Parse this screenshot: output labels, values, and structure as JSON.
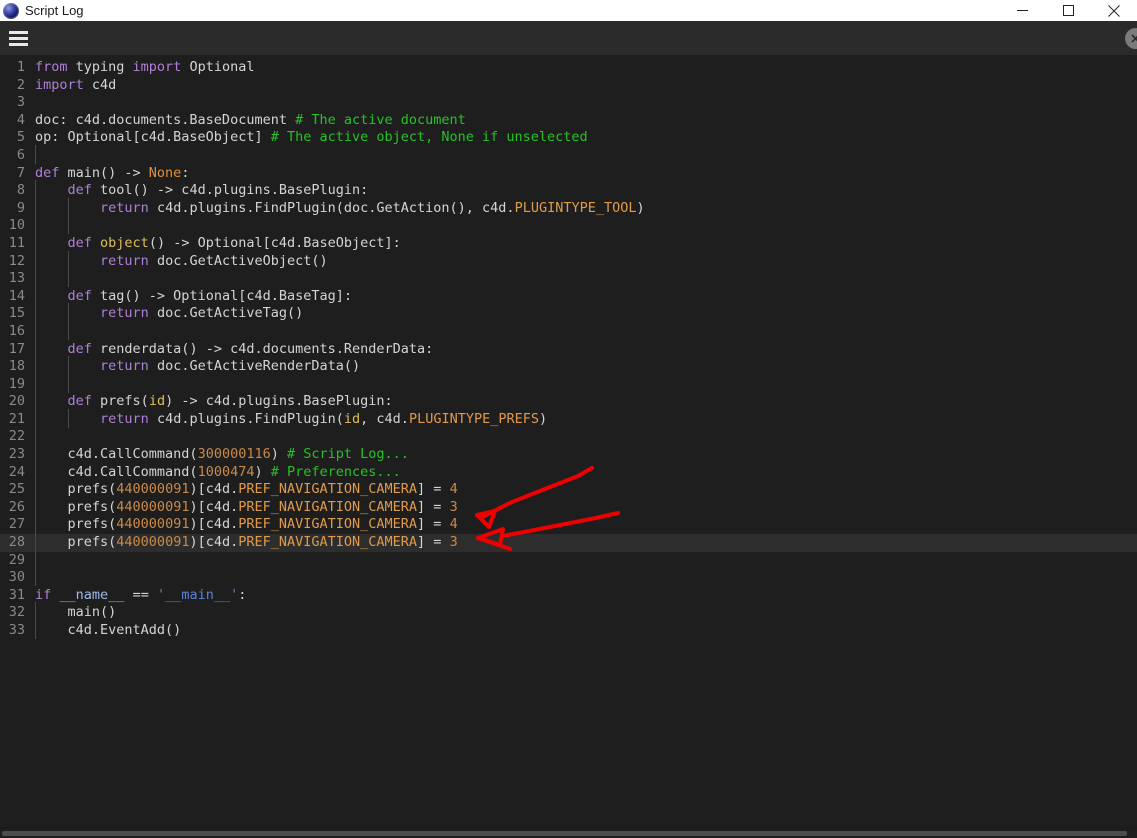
{
  "window": {
    "title": "Script Log",
    "app_icon": "c4d-sphere-icon",
    "controls": [
      {
        "name": "minimize-button",
        "glyph": "minimize-icon"
      },
      {
        "name": "maximize-button",
        "glyph": "maximize-icon"
      },
      {
        "name": "close-button",
        "glyph": "close-icon"
      }
    ]
  },
  "toolbar": {
    "menu_icon": "hamburger-menu-icon",
    "right_icon": "close-circle-icon"
  },
  "editor": {
    "current_line": 28,
    "total_lines": 33,
    "colors": {
      "background": "#1e1e1e",
      "gutter_text": "#8a8a8a",
      "current_line_bg": "#2d2d2d",
      "keyword": "#b07fd8",
      "builtin": "#e0bf56",
      "comment": "#26c226",
      "constant": "#e09a4a",
      "number": "#c98a49",
      "string": "#5a82d8",
      "plain": "#d4d4d4",
      "annotation": "#ee0000"
    },
    "lines": [
      {
        "n": 1,
        "indent": 0,
        "tokens": [
          {
            "t": "from",
            "c": "kw"
          },
          {
            "t": " typing ",
            "c": "plain"
          },
          {
            "t": "import",
            "c": "kw"
          },
          {
            "t": " Optional",
            "c": "plain"
          }
        ]
      },
      {
        "n": 2,
        "indent": 0,
        "tokens": [
          {
            "t": "import",
            "c": "kw"
          },
          {
            "t": " c4d",
            "c": "plain"
          }
        ]
      },
      {
        "n": 3,
        "indent": 0,
        "tokens": []
      },
      {
        "n": 4,
        "indent": 0,
        "tokens": [
          {
            "t": "doc: c4d.documents.BaseDocument ",
            "c": "plain"
          },
          {
            "t": "# The active document",
            "c": "cmt"
          }
        ]
      },
      {
        "n": 5,
        "indent": 0,
        "tokens": [
          {
            "t": "op: Optional[c4d.BaseObject] ",
            "c": "plain"
          },
          {
            "t": "# The active object, None if unselected",
            "c": "cmt"
          }
        ]
      },
      {
        "n": 6,
        "indent": 1,
        "tokens": []
      },
      {
        "n": 7,
        "indent": 0,
        "tokens": [
          {
            "t": "def",
            "c": "kw"
          },
          {
            "t": " main() -> ",
            "c": "plain"
          },
          {
            "t": "None",
            "c": "const"
          },
          {
            "t": ":",
            "c": "plain"
          }
        ]
      },
      {
        "n": 8,
        "indent": 1,
        "tokens": [
          {
            "t": "def",
            "c": "kw"
          },
          {
            "t": " tool() -> c4d.plugins.BasePlugin:",
            "c": "plain"
          }
        ]
      },
      {
        "n": 9,
        "indent": 2,
        "tokens": [
          {
            "t": "return",
            "c": "kw"
          },
          {
            "t": " c4d.plugins.FindPlugin(doc.GetAction(), c4d.",
            "c": "plain"
          },
          {
            "t": "PLUGINTYPE_TOOL",
            "c": "cst"
          },
          {
            "t": ")",
            "c": "plain"
          }
        ]
      },
      {
        "n": 10,
        "indent": 2,
        "tokens": []
      },
      {
        "n": 11,
        "indent": 1,
        "tokens": [
          {
            "t": "def",
            "c": "kw"
          },
          {
            "t": " ",
            "c": "plain"
          },
          {
            "t": "object",
            "c": "bi"
          },
          {
            "t": "() -> Optional[c4d.BaseObject]:",
            "c": "plain"
          }
        ]
      },
      {
        "n": 12,
        "indent": 2,
        "tokens": [
          {
            "t": "return",
            "c": "kw"
          },
          {
            "t": " doc.GetActiveObject()",
            "c": "plain"
          }
        ]
      },
      {
        "n": 13,
        "indent": 2,
        "tokens": []
      },
      {
        "n": 14,
        "indent": 1,
        "tokens": [
          {
            "t": "def",
            "c": "kw"
          },
          {
            "t": " tag() -> Optional[c4d.BaseTag]:",
            "c": "plain"
          }
        ]
      },
      {
        "n": 15,
        "indent": 2,
        "tokens": [
          {
            "t": "return",
            "c": "kw"
          },
          {
            "t": " doc.GetActiveTag()",
            "c": "plain"
          }
        ]
      },
      {
        "n": 16,
        "indent": 2,
        "tokens": []
      },
      {
        "n": 17,
        "indent": 1,
        "tokens": [
          {
            "t": "def",
            "c": "kw"
          },
          {
            "t": " renderdata() -> c4d.documents.RenderData:",
            "c": "plain"
          }
        ]
      },
      {
        "n": 18,
        "indent": 2,
        "tokens": [
          {
            "t": "return",
            "c": "kw"
          },
          {
            "t": " doc.GetActiveRenderData()",
            "c": "plain"
          }
        ]
      },
      {
        "n": 19,
        "indent": 2,
        "tokens": []
      },
      {
        "n": 20,
        "indent": 1,
        "tokens": [
          {
            "t": "def",
            "c": "kw"
          },
          {
            "t": " prefs(",
            "c": "plain"
          },
          {
            "t": "id",
            "c": "bi"
          },
          {
            "t": ") -> c4d.plugins.BasePlugin:",
            "c": "plain"
          }
        ]
      },
      {
        "n": 21,
        "indent": 2,
        "tokens": [
          {
            "t": "return",
            "c": "kw"
          },
          {
            "t": " c4d.plugins.FindPlugin(",
            "c": "plain"
          },
          {
            "t": "id",
            "c": "bi"
          },
          {
            "t": ", c4d.",
            "c": "plain"
          },
          {
            "t": "PLUGINTYPE_PREFS",
            "c": "cst"
          },
          {
            "t": ")",
            "c": "plain"
          }
        ]
      },
      {
        "n": 22,
        "indent": 1,
        "tokens": []
      },
      {
        "n": 23,
        "indent": 1,
        "tokens": [
          {
            "t": "c4d.CallCommand(",
            "c": "plain"
          },
          {
            "t": "300000116",
            "c": "num"
          },
          {
            "t": ") ",
            "c": "plain"
          },
          {
            "t": "# Script Log...",
            "c": "cmt"
          }
        ]
      },
      {
        "n": 24,
        "indent": 1,
        "tokens": [
          {
            "t": "c4d.CallCommand(",
            "c": "plain"
          },
          {
            "t": "1000474",
            "c": "num"
          },
          {
            "t": ") ",
            "c": "plain"
          },
          {
            "t": "# Preferences...",
            "c": "cmt"
          }
        ]
      },
      {
        "n": 25,
        "indent": 1,
        "tokens": [
          {
            "t": "prefs(",
            "c": "plain"
          },
          {
            "t": "440000091",
            "c": "num"
          },
          {
            "t": ")[c4d.",
            "c": "plain"
          },
          {
            "t": "PREF_NAVIGATION_CAMERA",
            "c": "cst"
          },
          {
            "t": "] = ",
            "c": "plain"
          },
          {
            "t": "4",
            "c": "num"
          }
        ]
      },
      {
        "n": 26,
        "indent": 1,
        "tokens": [
          {
            "t": "prefs(",
            "c": "plain"
          },
          {
            "t": "440000091",
            "c": "num"
          },
          {
            "t": ")[c4d.",
            "c": "plain"
          },
          {
            "t": "PREF_NAVIGATION_CAMERA",
            "c": "cst"
          },
          {
            "t": "] = ",
            "c": "plain"
          },
          {
            "t": "3",
            "c": "num"
          }
        ]
      },
      {
        "n": 27,
        "indent": 1,
        "tokens": [
          {
            "t": "prefs(",
            "c": "plain"
          },
          {
            "t": "440000091",
            "c": "num"
          },
          {
            "t": ")[c4d.",
            "c": "plain"
          },
          {
            "t": "PREF_NAVIGATION_CAMERA",
            "c": "cst"
          },
          {
            "t": "] = ",
            "c": "plain"
          },
          {
            "t": "4",
            "c": "num"
          }
        ]
      },
      {
        "n": 28,
        "indent": 1,
        "tokens": [
          {
            "t": "prefs(",
            "c": "plain"
          },
          {
            "t": "440000091",
            "c": "num"
          },
          {
            "t": ")[c4d.",
            "c": "plain"
          },
          {
            "t": "PREF_NAVIGATION_CAMERA",
            "c": "cst"
          },
          {
            "t": "] = ",
            "c": "plain"
          },
          {
            "t": "3",
            "c": "num"
          }
        ]
      },
      {
        "n": 29,
        "indent": 1,
        "tokens": []
      },
      {
        "n": 30,
        "indent": 1,
        "tokens": []
      },
      {
        "n": 31,
        "indent": 0,
        "tokens": [
          {
            "t": "if",
            "c": "kw"
          },
          {
            "t": " ",
            "c": "plain"
          },
          {
            "t": "__name__",
            "c": "dun"
          },
          {
            "t": " == ",
            "c": "plain"
          },
          {
            "t": "'__main__'",
            "c": "str"
          },
          {
            "t": ":",
            "c": "plain"
          }
        ]
      },
      {
        "n": 32,
        "indent": 1,
        "tokens": [
          {
            "t": "main()",
            "c": "plain"
          }
        ]
      },
      {
        "n": 33,
        "indent": 1,
        "tokens": [
          {
            "t": "c4d.EventAdd()",
            "c": "plain"
          }
        ]
      }
    ]
  },
  "annotations": [
    {
      "name": "arrow-to-line-27",
      "target_line": 27
    },
    {
      "name": "arrow-to-line-28",
      "target_line": 28
    }
  ],
  "scrollbar": {
    "orientation": "horizontal"
  }
}
